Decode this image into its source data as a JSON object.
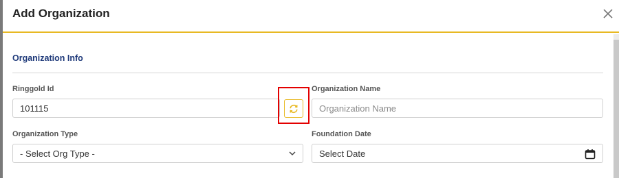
{
  "modal": {
    "title": "Add Organization",
    "close_label": "×"
  },
  "section": {
    "title": "Organization Info"
  },
  "fields": {
    "ringgold": {
      "label": "Ringgold Id",
      "value": "101115"
    },
    "org_name": {
      "label": "Organization Name",
      "placeholder": "Organization Name"
    },
    "org_type": {
      "label": "Organization Type",
      "selected": "- Select Org Type -"
    },
    "foundation_date": {
      "label": "Foundation Date",
      "placeholder": "Select Date"
    }
  },
  "icons": {
    "refresh": "refresh-icon",
    "close": "close-icon",
    "chevron": "chevron-down-icon",
    "calendar": "calendar-icon"
  },
  "colors": {
    "accent": "#e8b923",
    "section_title": "#1f3a7a",
    "highlight": "#e30000"
  }
}
